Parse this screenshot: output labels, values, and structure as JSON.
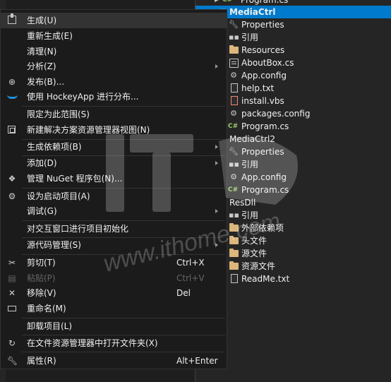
{
  "context_menu": {
    "items": [
      {
        "label": "生成(U)",
        "icon": "build-icon",
        "shortcut": "",
        "submenu": false,
        "disabled": false
      },
      {
        "label": "重新生成(E)",
        "icon": "",
        "shortcut": "",
        "submenu": false,
        "disabled": false
      },
      {
        "label": "清理(N)",
        "icon": "",
        "shortcut": "",
        "submenu": false,
        "disabled": false
      },
      {
        "label": "分析(Z)",
        "icon": "",
        "shortcut": "",
        "submenu": true,
        "disabled": false
      },
      {
        "label": "发布(B)...",
        "icon": "publish-globe-icon",
        "shortcut": "",
        "submenu": false,
        "disabled": false
      },
      {
        "label": "使用 HockeyApp 进行分布...",
        "icon": "hockeyapp-icon",
        "shortcut": "",
        "submenu": false,
        "disabled": false
      },
      {
        "label": "限定为此范围(S)",
        "icon": "",
        "shortcut": "",
        "submenu": false,
        "disabled": false
      },
      {
        "label": "新建解决方案资源管理器视图(N)",
        "icon": "new-view-icon",
        "shortcut": "",
        "submenu": false,
        "disabled": false
      },
      {
        "label": "生成依赖项(B)",
        "icon": "",
        "shortcut": "",
        "submenu": true,
        "disabled": false
      },
      {
        "label": "添加(D)",
        "icon": "",
        "shortcut": "",
        "submenu": true,
        "disabled": false
      },
      {
        "label": "管理 NuGet 程序包(N)...",
        "icon": "nuget-icon",
        "shortcut": "",
        "submenu": false,
        "disabled": false
      },
      {
        "label": "设为启动项目(A)",
        "icon": "gear-icon",
        "shortcut": "",
        "submenu": false,
        "disabled": false
      },
      {
        "label": "调试(G)",
        "icon": "",
        "shortcut": "",
        "submenu": true,
        "disabled": false
      },
      {
        "label": "对交互窗口进行项目初始化",
        "icon": "",
        "shortcut": "",
        "submenu": false,
        "disabled": false
      },
      {
        "label": "源代码管理(S)",
        "icon": "",
        "shortcut": "",
        "submenu": true,
        "disabled": false
      },
      {
        "label": "剪切(T)",
        "icon": "scissors-icon",
        "shortcut": "Ctrl+X",
        "submenu": false,
        "disabled": false
      },
      {
        "label": "粘贴(P)",
        "icon": "paste-icon",
        "shortcut": "Ctrl+V",
        "submenu": false,
        "disabled": true
      },
      {
        "label": "移除(V)",
        "icon": "remove-x-icon",
        "shortcut": "Del",
        "submenu": false,
        "disabled": false
      },
      {
        "label": "重命名(M)",
        "icon": "rename-icon",
        "shortcut": "",
        "submenu": false,
        "disabled": false
      },
      {
        "label": "卸载项目(L)",
        "icon": "",
        "shortcut": "",
        "submenu": false,
        "disabled": false
      },
      {
        "label": "在文件资源管理器中打开文件夹(X)",
        "icon": "open-folder-arrow-icon",
        "shortcut": "",
        "submenu": false,
        "disabled": false
      },
      {
        "label": "属性(R)",
        "icon": "wrench-icon",
        "shortcut": "Alt+Enter",
        "submenu": false,
        "disabled": false
      }
    ]
  },
  "solution_explorer": {
    "rows": [
      {
        "label": "Program.cs",
        "icon": "cs-file-icon",
        "selected": false
      },
      {
        "label": "MediaCtrl",
        "icon": "project-icon",
        "selected": true
      },
      {
        "label": "Properties",
        "icon": "wrench-icon",
        "selected": false
      },
      {
        "label": "引用",
        "icon": "references-icon",
        "selected": false
      },
      {
        "label": "Resources",
        "icon": "folder-icon",
        "selected": false
      },
      {
        "label": "AboutBox.cs",
        "icon": "form-file-icon",
        "selected": false
      },
      {
        "label": "App.config",
        "icon": "config-file-icon",
        "selected": false
      },
      {
        "label": "help.txt",
        "icon": "text-file-icon",
        "selected": false
      },
      {
        "label": "install.vbs",
        "icon": "script-file-icon",
        "selected": false
      },
      {
        "label": "packages.config",
        "icon": "config-file-icon",
        "selected": false
      },
      {
        "label": "Program.cs",
        "icon": "cs-file-icon",
        "selected": false
      },
      {
        "label": "MediaCtrl2",
        "icon": "project-icon",
        "selected": false
      },
      {
        "label": "Properties",
        "icon": "wrench-icon",
        "selected": false
      },
      {
        "label": "引用",
        "icon": "references-icon",
        "selected": false
      },
      {
        "label": "App.config",
        "icon": "config-file-icon",
        "selected": false
      },
      {
        "label": "Program.cs",
        "icon": "cs-file-icon",
        "selected": false
      },
      {
        "label": "ResDll",
        "icon": "project-icon",
        "selected": false
      },
      {
        "label": "引用",
        "icon": "references-icon",
        "selected": false
      },
      {
        "label": "外部依赖项",
        "icon": "folder-icon",
        "selected": false
      },
      {
        "label": "头文件",
        "icon": "folder-icon",
        "selected": false
      },
      {
        "label": "源文件",
        "icon": "folder-icon",
        "selected": false
      },
      {
        "label": "资源文件",
        "icon": "folder-icon",
        "selected": false
      },
      {
        "label": "ReadMe.txt",
        "icon": "text-file-icon",
        "selected": false
      }
    ]
  },
  "watermark": {
    "text": "www.ithome.com"
  },
  "colors": {
    "menu_bg": "#1b1b1c",
    "panel_bg": "#252526",
    "selection": "#007acc",
    "text": "#f1f1f1",
    "disabled_text": "#656565"
  }
}
